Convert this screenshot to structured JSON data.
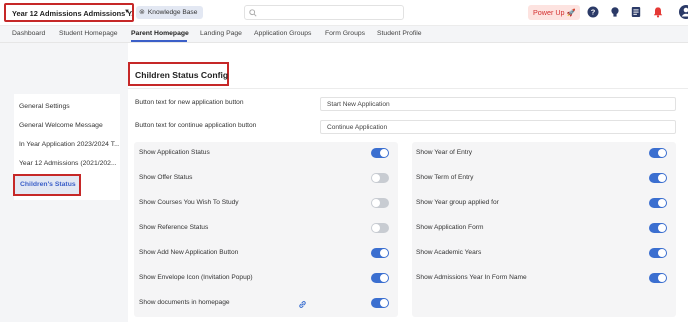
{
  "header": {
    "app_selector": "Year 12 Admissions Admissions Y...",
    "knowledge_base": "Knowledge Base",
    "power_up": "Power Up",
    "accent": "#3b5fc8",
    "highlight": "#c62828"
  },
  "tabs": [
    "Dashboard",
    "Student Homepage",
    "Parent Homepage",
    "Landing Page",
    "Application Groups",
    "Form Groups",
    "Student Profile"
  ],
  "active_tab": "Parent Homepage",
  "sidebar": {
    "items": [
      "General Settings",
      "General Welcome Message",
      "In Year Application 2023/2024 T...",
      "Year 12 Admissions (2021/202..."
    ],
    "active": "Children's Status"
  },
  "config": {
    "title": "Children Status Config",
    "fields": [
      {
        "label": "Button text for new application button",
        "value": "Start New Application"
      },
      {
        "label": "Button text for continue application button",
        "value": "Continue Application"
      }
    ],
    "left_toggles": [
      {
        "label": "Show Application Status",
        "on": true
      },
      {
        "label": "Show Offer Status",
        "on": false
      },
      {
        "label": "Show Courses You Wish To Study",
        "on": false
      },
      {
        "label": "Show Reference Status",
        "on": false
      },
      {
        "label": "Show Add New Application Button",
        "on": true
      },
      {
        "label": "Show Envelope Icon (Invitation Popup)",
        "on": true
      },
      {
        "label": "Show documents in homepage",
        "on": true
      }
    ],
    "right_toggles": [
      {
        "label": "Show Year of Entry",
        "on": true
      },
      {
        "label": "Show Term of Entry",
        "on": true
      },
      {
        "label": "Show Year group applied for",
        "on": true
      },
      {
        "label": "Show Application Form",
        "on": true
      },
      {
        "label": "Show Academic Years",
        "on": true
      },
      {
        "label": "Show Admissions Year In Form Name",
        "on": true
      }
    ]
  }
}
